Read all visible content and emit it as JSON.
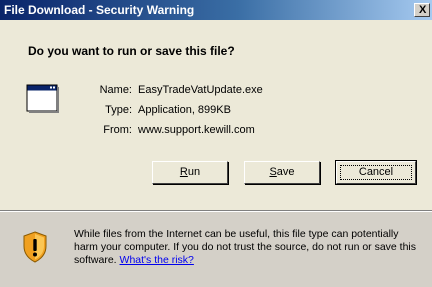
{
  "window": {
    "title": "File Download - Security Warning",
    "close_glyph": "X"
  },
  "question": "Do you want to run or save this file?",
  "file": {
    "icon": "application-window-icon",
    "name_label": "Name:",
    "name_value": "EasyTradeVatUpdate.exe",
    "type_label": "Type:",
    "type_value": "Application, 899KB",
    "from_label": "From:",
    "from_value": "www.support.kewill.com"
  },
  "buttons": {
    "run_hotkey": "R",
    "run_rest": "un",
    "save_hotkey": "S",
    "save_rest": "ave",
    "cancel": "Cancel"
  },
  "warning": {
    "icon": "shield-warning-icon",
    "text": "While files from the Internet can be useful, this file type can potentially harm your computer. If you do not trust the source, do not run or save this software. ",
    "link": "What's the risk?"
  },
  "colors": {
    "titlebar_start": "#0a246a",
    "titlebar_end": "#a6caf0",
    "dialog_bg": "#ece9d8",
    "lower_bg": "#d4d0c8",
    "link": "#0000ee",
    "shield_orange": "#f0a020",
    "shield_black": "#000000"
  }
}
